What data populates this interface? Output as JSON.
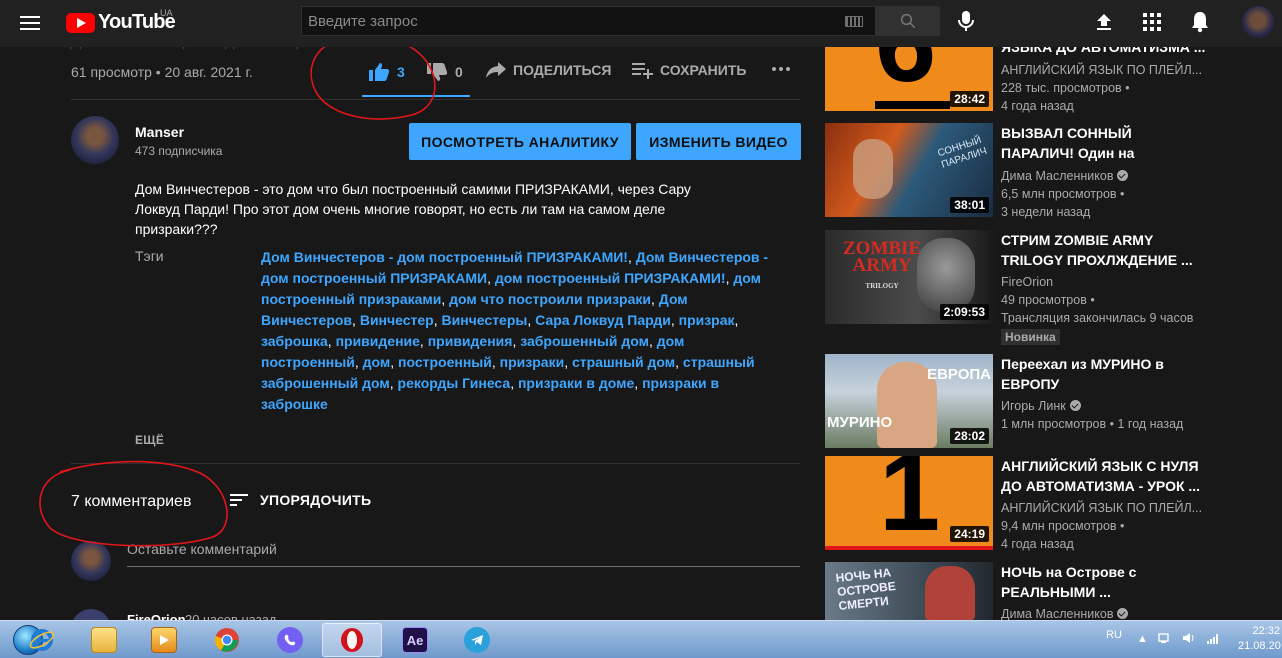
{
  "masthead": {
    "logo_text": "YouTube",
    "country": "UA",
    "search_placeholder": "Введите запрос"
  },
  "video": {
    "title_partial": "Дом Винчестеров - дом построенный ПРИЗРАКАМИ!",
    "views_date": "61 просмотр • 20 авг. 2021 г.",
    "likes": "3",
    "dislikes": "0",
    "share_label": "ПОДЕЛИТЬСЯ",
    "save_label": "СОХРАНИТЬ"
  },
  "channel": {
    "name": "Manser",
    "subscribers": "473 подписчика",
    "analytics_button": "ПОСМОТРЕТЬ АНАЛИТИКУ",
    "edit_button": "ИЗМЕНИТЬ ВИДЕО"
  },
  "description": {
    "text": "Дом Винчестеров - это дом что был построенный самими ПРИЗРАКАМИ, через Сару Локвуд Парди! Про этот дом очень многие говорят, но есть ли там на самом деле призраки???",
    "tags_label": "Тэги",
    "tags": [
      "Дом Винчестеров - дом построенный ПРИЗРАКАМИ!",
      "Дом Винчестеров - дом построенный ПРИЗРАКАМИ",
      "дом построенный ПРИЗРАКАМИ!",
      "дом построенный призраками",
      "дом что построили призраки",
      "Дом Винчестеров",
      "Винчестер",
      "Винчестеры",
      "Сара Локвуд Парди",
      "призрак",
      "заброшка",
      "привидение",
      "привидения",
      "заброшенный дом",
      "дом построенный",
      "дом",
      "построенный",
      "призраки",
      "страшный дом",
      "страшный заброшенный дом",
      "рекорды Гинеса",
      "призраки в доме",
      "призраки в заброшке"
    ],
    "more_label": "ЕЩЁ"
  },
  "comments": {
    "count_label": "7 комментариев",
    "sort_label": "УПОРЯДОЧИТЬ",
    "input_placeholder": "Оставьте комментарий",
    "first_author": "FireOrion",
    "first_time": "20 часов назад"
  },
  "sidebar": {
    "videos": [
      {
        "title": "ПРАКТИКА АНГЛИЙСКОГО ЯЗЫКА ДО АВТОМАТИЗМА ...",
        "channel": "АНГЛИЙСКИЙ ЯЗЫК ПО ПЛЕЙЛ...",
        "views": "228 тыс. просмотров",
        "age": "4 года назад",
        "duration": "28:42"
      },
      {
        "title": "ВЫЗВАЛ СОННЫЙ ПАРАЛИЧ! Один на ЗАБРОШКЕ - ...",
        "channel": "Дима Масленников",
        "views": "6,5 млн просмотров",
        "age": "3 недели назад",
        "duration": "38:01"
      },
      {
        "title": "СТРИМ ZOMBIE ARMY TRILOGY ПРОХЛЖДЕНИЕ ...",
        "channel": "FireOrion",
        "views": "49 просмотров",
        "age": "Трансляция закончилась 9 часов",
        "duration": "2:09:53",
        "badge": "Новинка"
      },
      {
        "title": "Переехал из МУРИНО в ЕВРОПУ",
        "channel": "Игорь Линк",
        "views": "1 млн просмотров",
        "age": "1 год назад",
        "duration": "28:02"
      },
      {
        "title": "АНГЛИЙСКИЙ ЯЗЫК С НУЛЯ ДО АВТОМАТИЗМА - УРОК ...",
        "channel": "АНГЛИЙСКИЙ ЯЗЫК ПО ПЛЕЙЛ...",
        "views": "9,4 млн просмотров",
        "age": "4 года назад",
        "duration": "24:19"
      },
      {
        "title": "НОЧЬ на Острове с РЕАЛЬНЫМИ ...",
        "channel": "Дима Масленников",
        "views": "",
        "age": "",
        "duration": ""
      }
    ],
    "thumb_texts": {
      "t1": "6",
      "t2a": "СОННЫЙ",
      "t2b": "ПАРАЛИЧ",
      "t3a": "ZOMBIE",
      "t3b": "ARMY",
      "t3c": "TRILOGY",
      "t4a": "ЕВРОПА",
      "t4b": "МУРИНО",
      "t5": "1",
      "t6a": "НОЧЬ НА",
      "t6b": "ОСТРОВЕ",
      "t6c": "СМЕРТИ"
    }
  },
  "taskbar": {
    "apps": [
      "Internet Explorer",
      "File Explorer",
      "Media Player",
      "Chrome",
      "Viber",
      "Opera",
      "After Effects",
      "Telegram"
    ],
    "ae_label": "Ae",
    "lang": "RU",
    "time": "22:32",
    "date": "21.08.20"
  },
  "colors": {
    "accent": "#3ea6ff",
    "annotation": "#e0161b",
    "background": "#181818",
    "masthead": "#212121"
  }
}
